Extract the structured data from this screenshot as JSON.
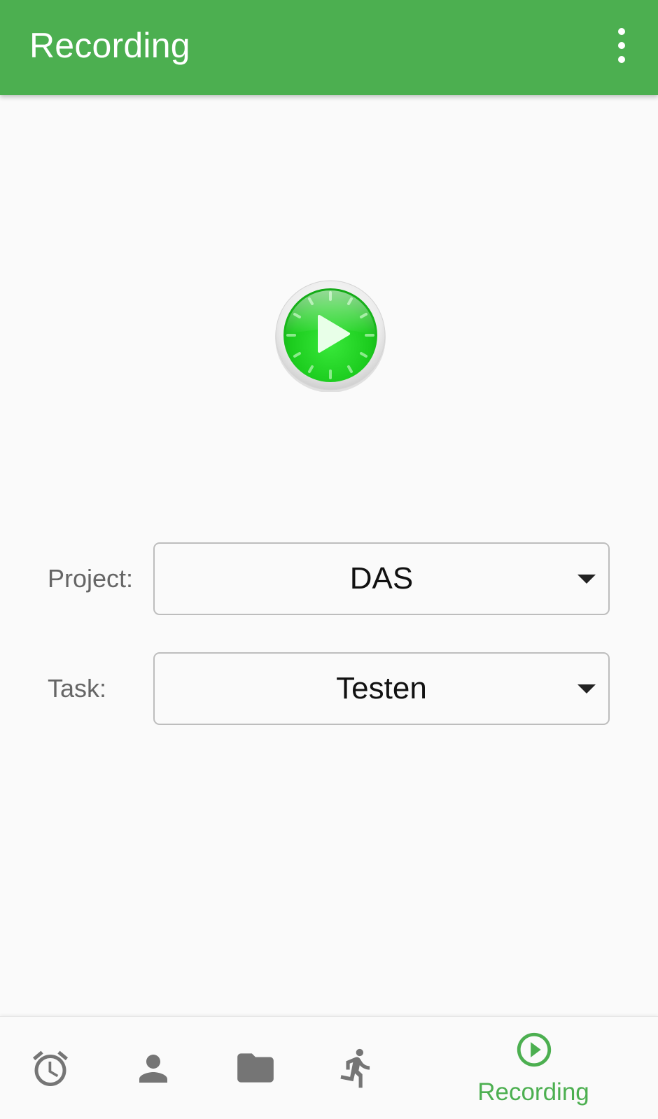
{
  "app_bar": {
    "title": "Recording",
    "menu_icon": "more-vert-icon",
    "background_color": "#4caf50"
  },
  "main": {
    "start_button_icon": "play-clock-icon",
    "project": {
      "label": "Project:",
      "value": "DAS"
    },
    "task": {
      "label": "Task:",
      "value": "Testen"
    }
  },
  "bottom_nav": {
    "active_color": "#4caf50",
    "inactive_color": "#757575",
    "items": [
      {
        "icon": "alarm-clock-icon",
        "label": ""
      },
      {
        "icon": "person-icon",
        "label": ""
      },
      {
        "icon": "folder-icon",
        "label": ""
      },
      {
        "icon": "running-icon",
        "label": ""
      },
      {
        "icon": "play-circle-icon",
        "label": "Recording",
        "active": true
      }
    ]
  }
}
